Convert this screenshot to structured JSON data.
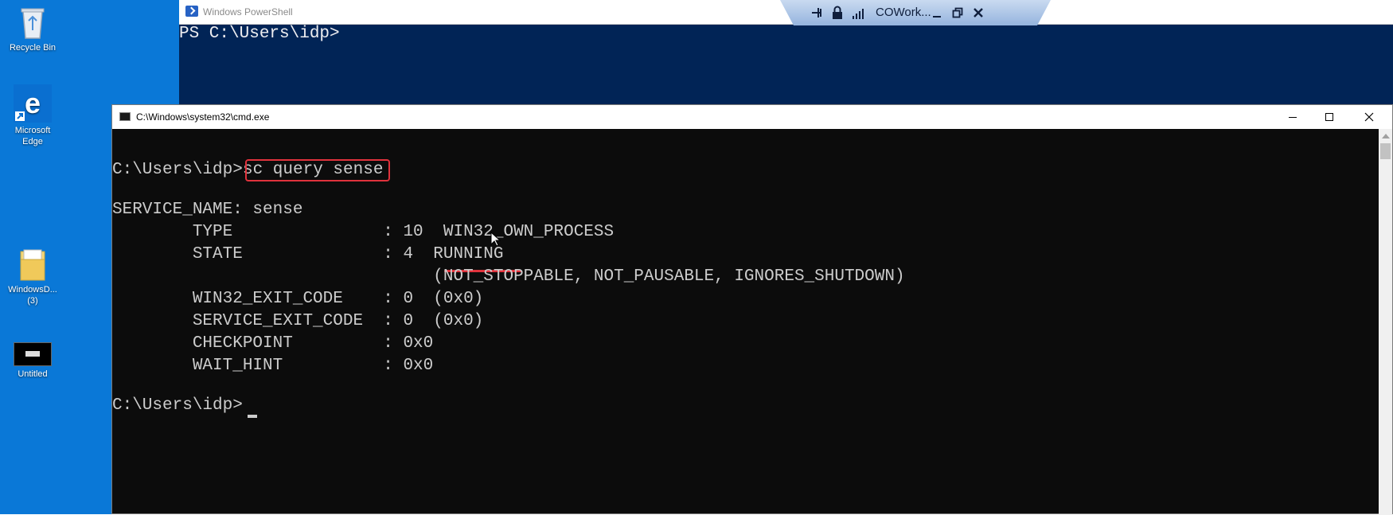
{
  "desktop": {
    "icons": [
      {
        "label": "Recycle Bin"
      },
      {
        "label": "Microsoft Edge"
      },
      {
        "label": "WindowsD... (3)"
      },
      {
        "label": "Untitled"
      }
    ]
  },
  "powershell": {
    "title": "Windows PowerShell",
    "prompt": "PS C:\\Users\\idp>"
  },
  "remote_bar": {
    "connection_name": "COWork...",
    "icons": [
      "pin-icon",
      "lock-icon",
      "signal-icon",
      "minimize-icon",
      "restore-icon",
      "close-icon"
    ]
  },
  "cmd": {
    "title": "C:\\Windows\\system32\\cmd.exe",
    "prompt": "C:\\Users\\idp>",
    "command": "sc query sense",
    "lines": [
      "SERVICE_NAME: sense",
      "        TYPE               : 10  WIN32_OWN_PROCESS",
      "        STATE              : 4  RUNNING",
      "                                (NOT_STOPPABLE, NOT_PAUSABLE, IGNORES_SHUTDOWN)",
      "        WIN32_EXIT_CODE    : 0  (0x0)",
      "        SERVICE_EXIT_CODE  : 0  (0x0)",
      "        CHECKPOINT         : 0x0",
      "        WAIT_HINT          : 0x0"
    ],
    "final_prompt": "C:\\Users\\idp>"
  },
  "colors": {
    "desktop_blue": "#0a78d7",
    "powershell_bg": "#012456",
    "cmd_bg": "#0c0c0c",
    "highlight_red": "#e0323c"
  }
}
